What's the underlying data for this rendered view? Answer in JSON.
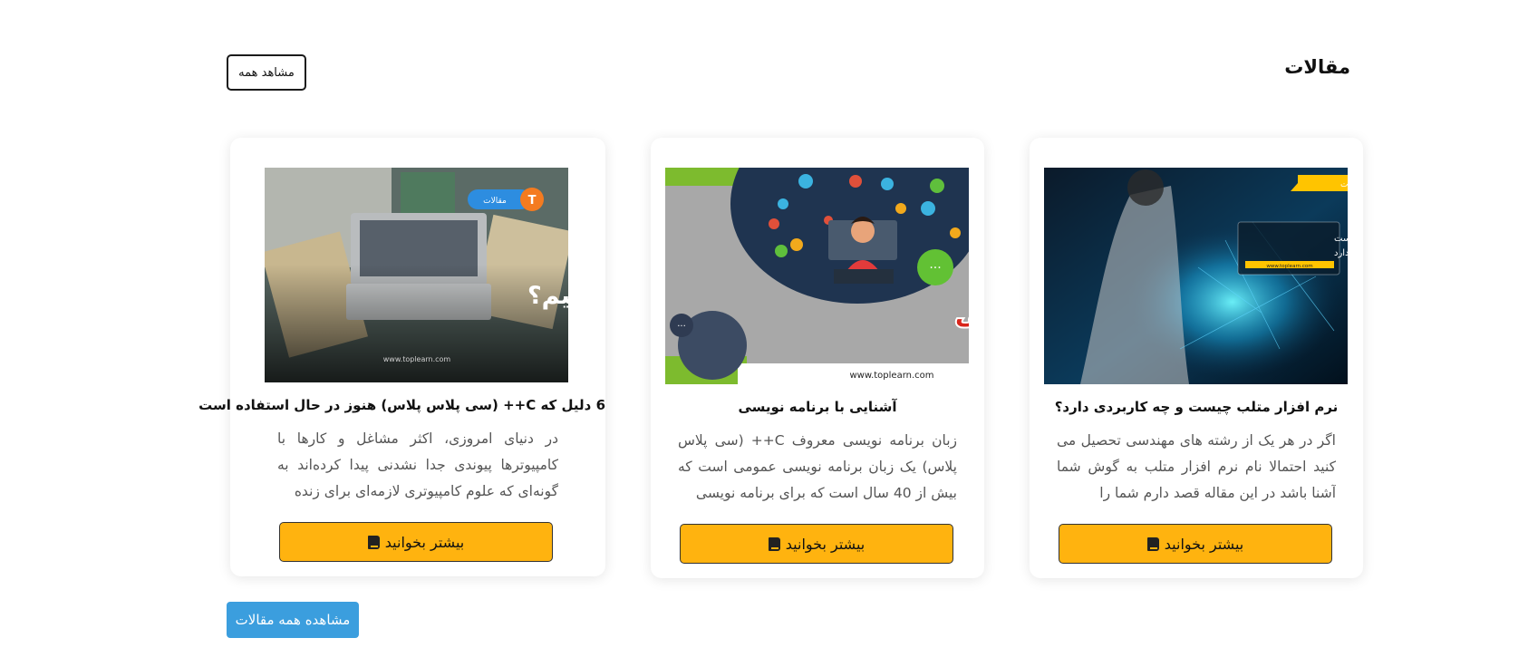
{
  "header": {
    "title": "مقالات",
    "view_all_label": "مشاهد همه"
  },
  "cards": [
    {
      "title": "نرم افزار متلب چیست و چه کاربردی دارد؟",
      "excerpt": "اگر در هر یک از رشته های مهندسی تحصیل می کنید احتمالا نام نرم افزار متلب به گوش شما آشنا باشد در این مقاله قصد دارم شما را",
      "button_label": "بیشتر بخوانید",
      "image": {
        "badge": "مقالات",
        "headline_line1": "نرم افزار متلب چیست",
        "headline_line2": "و چه کاربردی دارد",
        "site": "www.toplearn.com"
      }
    },
    {
      "title": "آشنایی با برنامه نویسی",
      "excerpt": "زبان برنامه نویسی معروف C++ (سی پلاس پلاس) یک زبان برنامه نویسی عمومی است که بیش از 40 سال است که برای برنامه نویسی",
      "button_label": "بیشتر بخوانید",
      "image": {
        "headline": "آشنایی با برنامه‌نویسی",
        "site": "www.toplearn.com"
      }
    },
    {
      "title": "6 دلیل که C++ (سی پلاس پلاس) هنوز در حال استفاده است",
      "excerpt": "در دنیای امروزی، اکثر مشاغل و کارها با کامپیوترها پیوندی جدا نشدنی پیدا کرده‌اند به گونه‌ای که علوم کامپیوتری لازمه‌ای برای زنده",
      "button_label": "بیشتر بخوانید",
      "image": {
        "badge": "مقالات",
        "headline": "چگونه آموزش ببینیم؟",
        "site": "www.toplearn.com"
      }
    }
  ],
  "footer": {
    "view_all_articles_label": "مشاهده همه مقالات"
  },
  "colors": {
    "accent_yellow": "#ffb30f",
    "button_blue": "#3b9ede"
  }
}
